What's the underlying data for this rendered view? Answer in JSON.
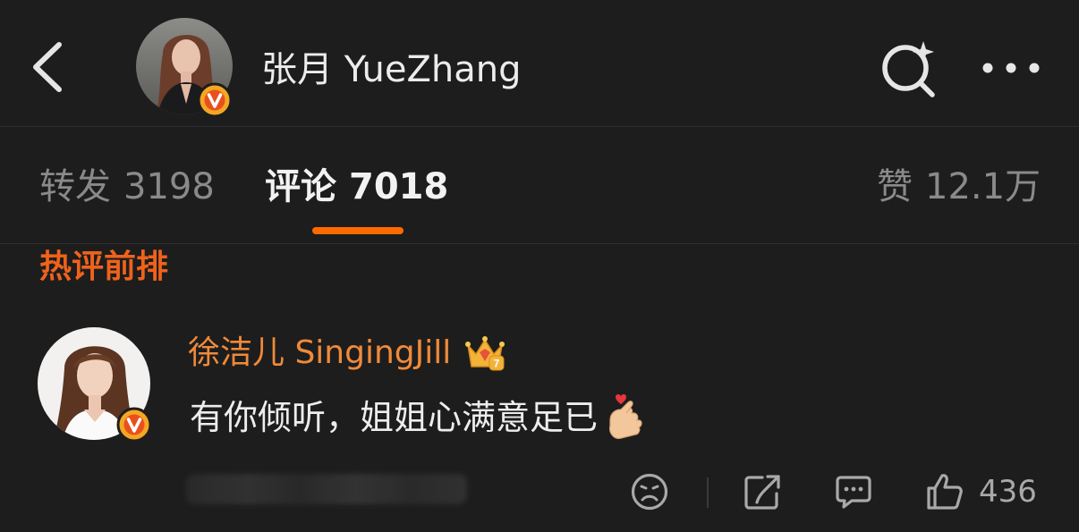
{
  "header": {
    "back_icon": "chevron-left-icon",
    "title": "张月 YueZhang",
    "verified": "verified-v-icon",
    "search_icon": "search-sparkle-icon",
    "more_icon": "more-horizontal-icon"
  },
  "tabs": [
    {
      "label": "转发",
      "count": "3198",
      "active": false
    },
    {
      "label": "评论",
      "count": "7018",
      "active": true
    },
    {
      "label": "赞",
      "count": "12.1万",
      "active": false
    }
  ],
  "hot_comments": {
    "section_title": "热评前排",
    "comment": {
      "user_name": "徐洁儿 SingingJill",
      "user_badge": "crown-level-7-icon",
      "text": "有你倾听，姐姐心满意足已",
      "emoji": "heart-hand-emoji",
      "actions": {
        "dislike_icon": "sad-face-icon",
        "share_icon": "share-icon",
        "comment_icon": "comment-bubble-icon",
        "like_icon": "thumbs-up-icon",
        "like_count": "436"
      }
    }
  },
  "colors": {
    "background": "#1d1d1d",
    "accent_orange": "#ff6a00",
    "section_title": "#f0621b",
    "username": "#ef8a3a",
    "verified_badge": "#f5a623"
  }
}
